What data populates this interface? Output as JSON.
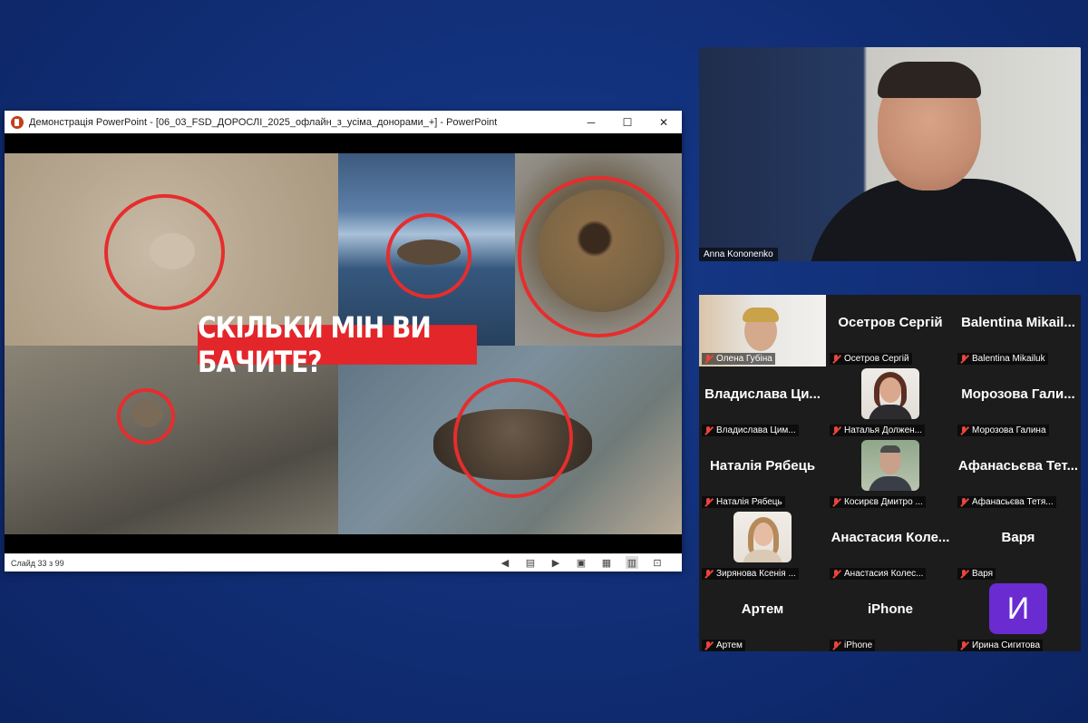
{
  "powerpoint": {
    "title": "Демонстрація PowerPoint - [06_03_FSD_ДОРОСЛІ_2025_офлайн_з_усіма_донорами_+] - PowerPoint",
    "minimize": "─",
    "maximize": "☐",
    "close": "✕",
    "slide_headline": "СКІЛЬКИ МІН ВИ БАЧИТЕ?",
    "status_text": "Слайд 33 з 99"
  },
  "speaker": {
    "name": "Anna Kononenko"
  },
  "gallery": {
    "tiles": [
      {
        "display": "",
        "label": "Олена Губіна"
      },
      {
        "display": "Осетров Сергій",
        "label": "Осетров Сергій"
      },
      {
        "display": "Balentina Mikail...",
        "label": "Balentina Mikailuk"
      },
      {
        "display": "Владислава Ци...",
        "label": "Владислава Цим..."
      },
      {
        "display": "",
        "label": "Наталья Должен..."
      },
      {
        "display": "Морозова Гали...",
        "label": "Морозова Галина"
      },
      {
        "display": "Наталія Рябець",
        "label": "Наталія Рябець"
      },
      {
        "display": "",
        "label": "Косирєв Дмитро ..."
      },
      {
        "display": "Афанасьєва Тет...",
        "label": "Афанасьєва Тетя..."
      },
      {
        "display": "",
        "label": "Зирянова Ксенія ..."
      },
      {
        "display": "Анастасия Коле...",
        "label": "Анастасия Колес..."
      },
      {
        "display": "Варя",
        "label": "Варя"
      },
      {
        "display": "Артем",
        "label": "Артем"
      },
      {
        "display": "iPhone",
        "label": "iPhone"
      },
      {
        "display": "И",
        "label": "Ирина Сигитова"
      }
    ]
  },
  "colors": {
    "background": "#12307a",
    "highlight_red": "#e3262a",
    "muted_mic": "#e8453c",
    "avatar_purple": "#6a2bd1"
  }
}
